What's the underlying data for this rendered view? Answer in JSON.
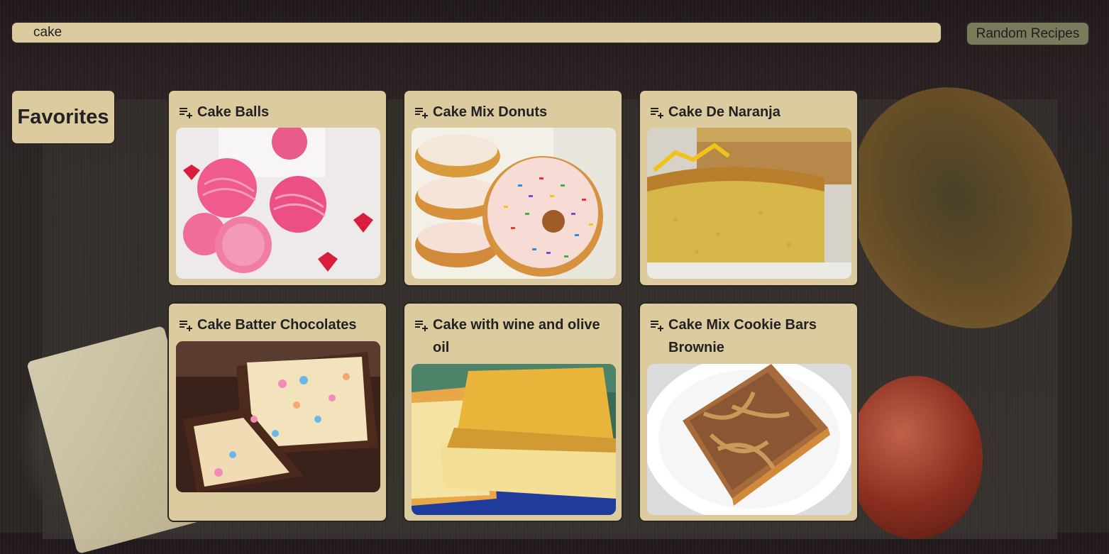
{
  "search": {
    "value": "cake"
  },
  "random_button": {
    "label": "Random Recipes"
  },
  "favorites": {
    "label": "Favorites"
  },
  "icons": {
    "add_to_list": "playlist-add-icon"
  },
  "colors": {
    "card_bg": "#dccb9e",
    "border": "#2a2622",
    "button_bg": "#7b7a5c",
    "text": "#222222"
  },
  "recipes": [
    {
      "title": "Cake Balls"
    },
    {
      "title": "Cake Mix Donuts"
    },
    {
      "title": "Cake De Naranja"
    },
    {
      "title": "Cake Batter Chocolates"
    },
    {
      "title": "Cake with wine and olive oil"
    },
    {
      "title": "Cake Mix Cookie Bars Brownie"
    }
  ]
}
